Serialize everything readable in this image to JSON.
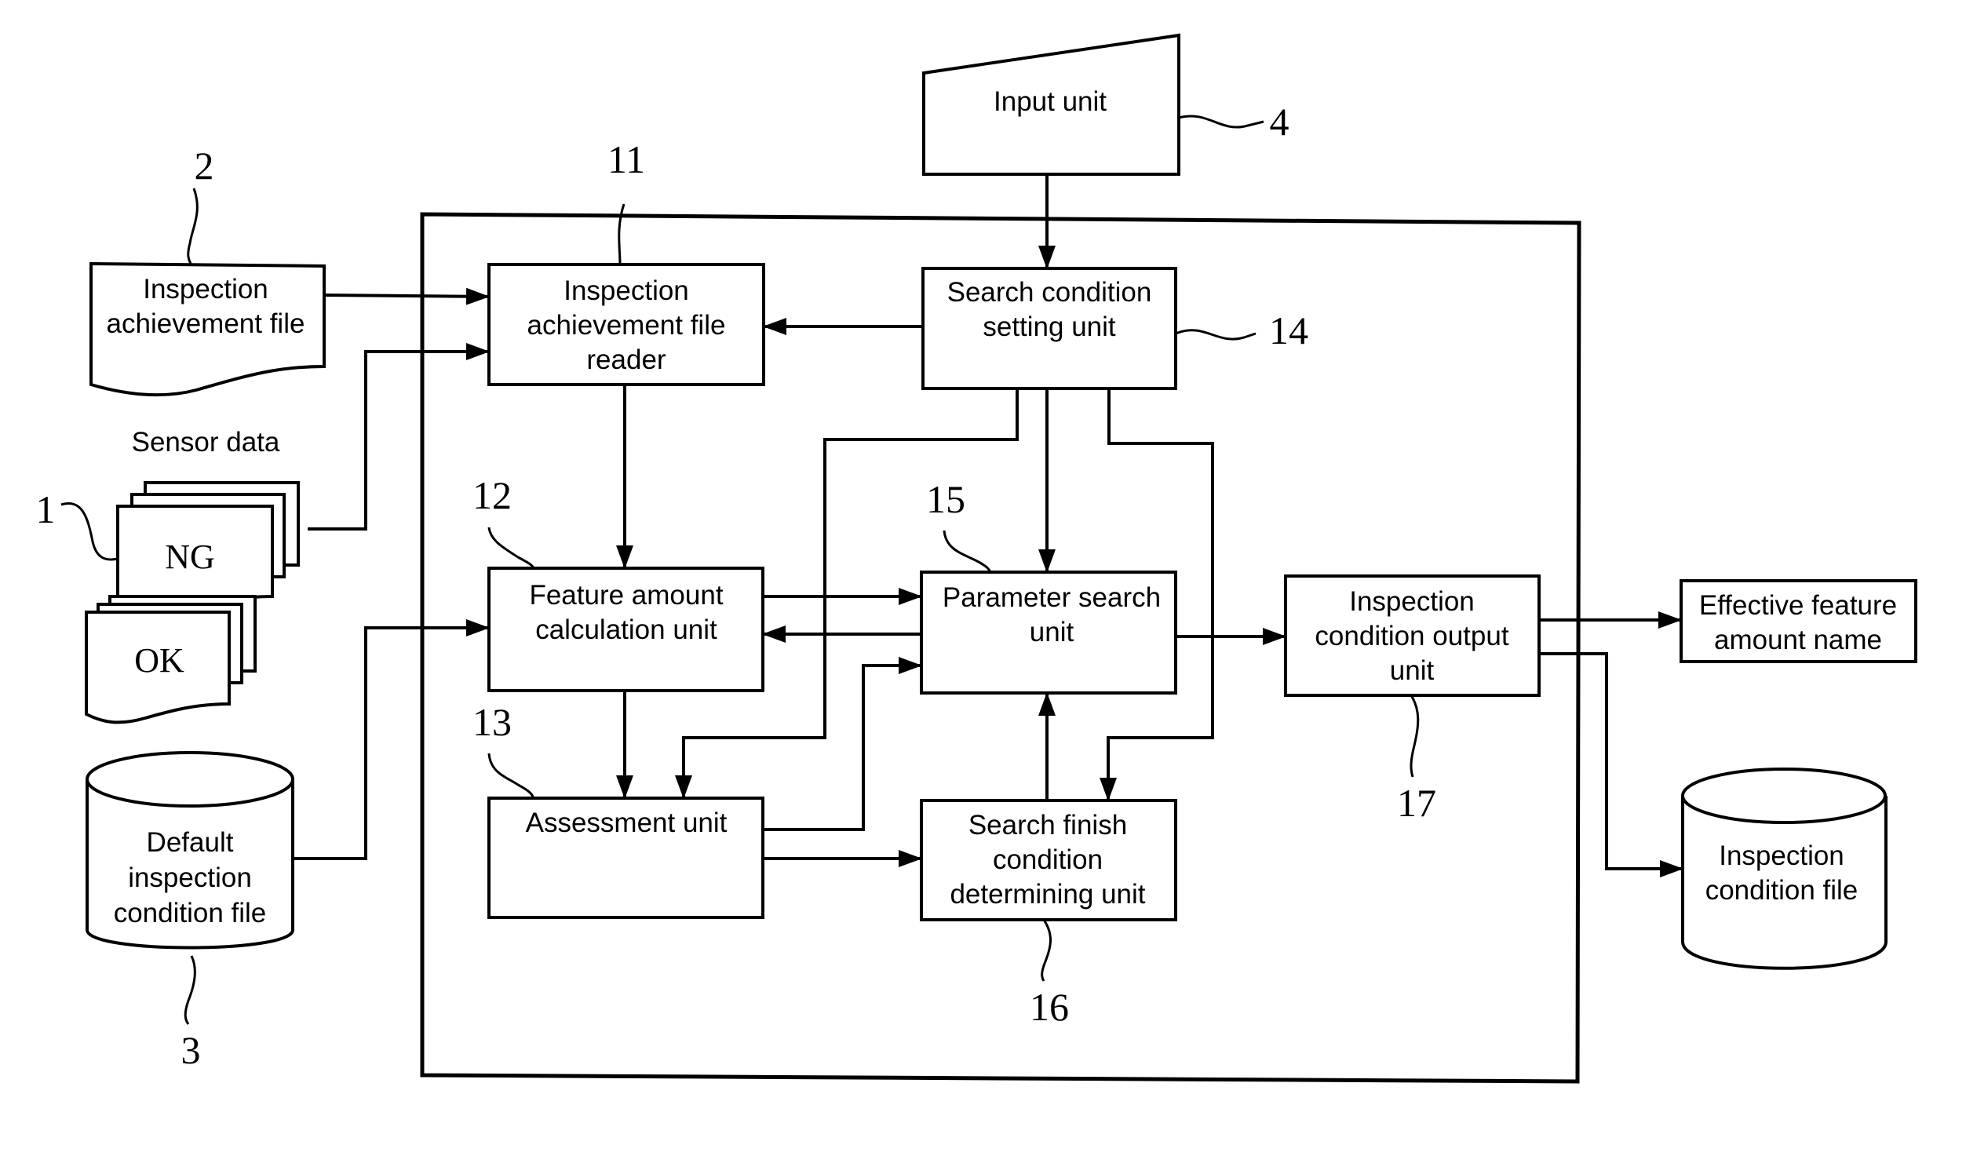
{
  "figure": {
    "type": "block-diagram",
    "external_inputs": {
      "input_unit": {
        "label": "Input unit",
        "ref": "4"
      },
      "inspection_achievement_file": {
        "lines": [
          "Inspection",
          "achievement file"
        ],
        "ref": "2"
      },
      "sensor_data": {
        "caption": "Sensor data",
        "ref": "1",
        "ng_label": "NG",
        "ok_label": "OK"
      },
      "default_inspection_condition_file": {
        "lines": [
          "Default",
          "inspection",
          "condition file"
        ],
        "ref": "3"
      }
    },
    "units": {
      "reader": {
        "lines": [
          "Inspection",
          "achievement file",
          "reader"
        ],
        "ref": "11"
      },
      "feature": {
        "lines": [
          "Feature amount",
          "calculation unit"
        ],
        "ref": "12"
      },
      "assessment": {
        "lines": [
          "Assessment unit"
        ],
        "ref": "13"
      },
      "search_condition": {
        "lines": [
          "Search condition",
          "setting unit"
        ],
        "ref": "14"
      },
      "parameter_search": {
        "lines": [
          "Parameter search",
          "unit"
        ],
        "ref": "15"
      },
      "search_finish": {
        "lines": [
          "Search finish",
          "condition",
          "determining unit"
        ],
        "ref": "16"
      },
      "output_unit": {
        "lines": [
          "Inspection",
          "condition output",
          "unit"
        ],
        "ref": "17"
      }
    },
    "outputs": {
      "effective_feature": {
        "lines": [
          "Effective feature",
          "amount name"
        ]
      },
      "inspection_condition_file": {
        "lines": [
          "Inspection",
          "condition file"
        ]
      }
    },
    "connections": [
      {
        "from": "input_unit",
        "to": "search_condition"
      },
      {
        "from": "inspection_achievement_file",
        "to": "reader"
      },
      {
        "from": "sensor_data",
        "to": "reader"
      },
      {
        "from": "search_condition",
        "to": "reader"
      },
      {
        "from": "reader",
        "to": "feature"
      },
      {
        "from": "default_inspection_condition_file",
        "to": "feature"
      },
      {
        "from": "feature",
        "to": "parameter_search"
      },
      {
        "from": "parameter_search",
        "to": "feature"
      },
      {
        "from": "feature",
        "to": "assessment"
      },
      {
        "from": "search_condition",
        "to": "assessment"
      },
      {
        "from": "search_condition",
        "to": "parameter_search"
      },
      {
        "from": "search_condition",
        "to": "search_finish"
      },
      {
        "from": "assessment",
        "to": "parameter_search"
      },
      {
        "from": "assessment",
        "to": "search_finish"
      },
      {
        "from": "search_finish",
        "to": "parameter_search"
      },
      {
        "from": "parameter_search",
        "to": "output_unit"
      },
      {
        "from": "output_unit",
        "to": "effective_feature"
      },
      {
        "from": "output_unit",
        "to": "inspection_condition_file"
      }
    ]
  }
}
